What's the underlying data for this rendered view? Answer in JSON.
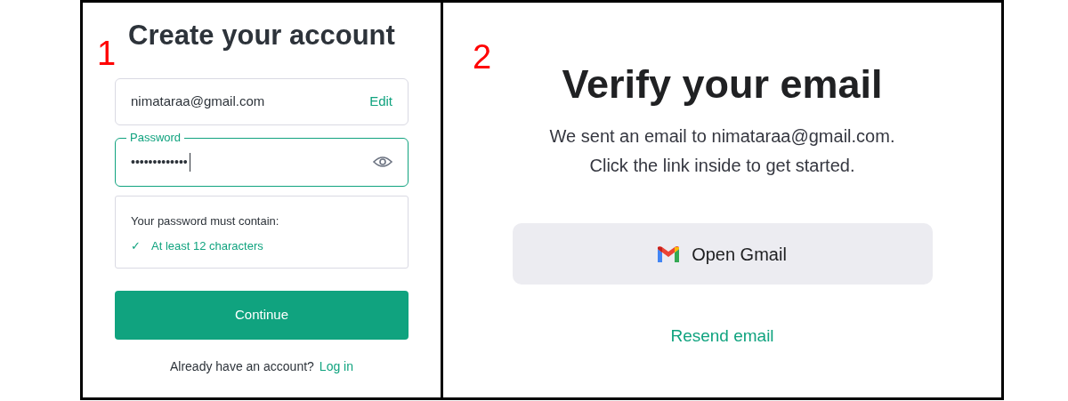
{
  "steps": [
    {
      "number": "1",
      "title": "Create your account",
      "email": {
        "value": "nimataraa@gmail.com",
        "action": "Edit"
      },
      "password": {
        "label": "Password",
        "value": "•••••••••••••",
        "focused": true
      },
      "requirements": {
        "title": "Your password must contain:",
        "items": [
          {
            "mark": "✓",
            "text": "At least 12 characters",
            "met": true
          }
        ]
      },
      "button": "Continue",
      "footer": {
        "text": "Already have an account?",
        "link": "Log in"
      }
    },
    {
      "number": "2",
      "title": "Verify your email",
      "message": [
        "We sent an email to nimataraa@gmail.com.",
        "Click the link inside to get started."
      ],
      "button": "Open Gmail",
      "link": "Resend email"
    }
  ]
}
